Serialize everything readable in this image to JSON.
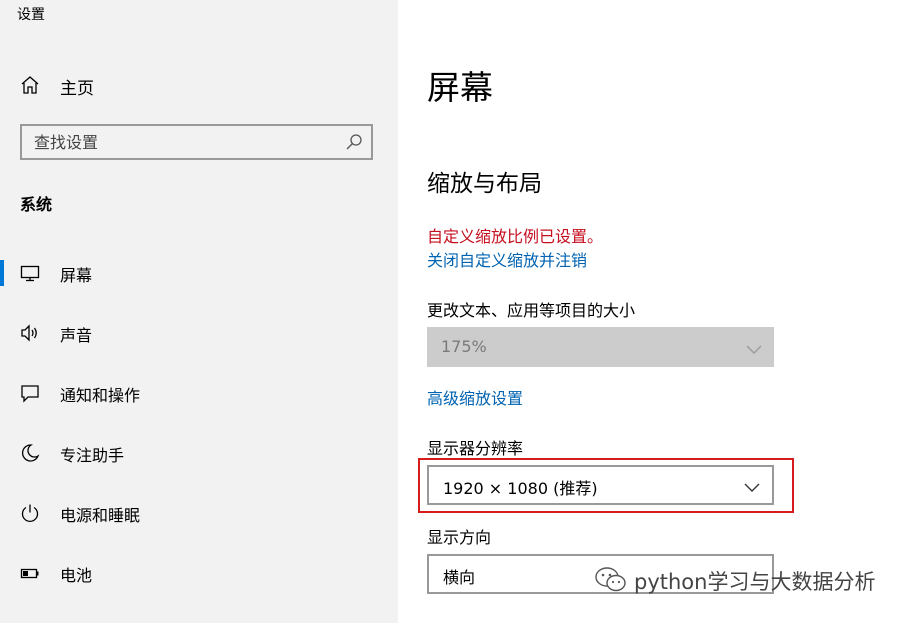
{
  "app": {
    "title": "设置"
  },
  "sidebar": {
    "home_label": "主页",
    "search": {
      "placeholder": "查找设置",
      "value": ""
    },
    "section_title": "系统",
    "items": [
      {
        "label": "屏幕",
        "icon": "monitor-icon",
        "selected": true
      },
      {
        "label": "声音",
        "icon": "speaker-icon",
        "selected": false
      },
      {
        "label": "通知和操作",
        "icon": "notification-icon",
        "selected": false
      },
      {
        "label": "专注助手",
        "icon": "moon-icon",
        "selected": false
      },
      {
        "label": "电源和睡眠",
        "icon": "power-icon",
        "selected": false
      },
      {
        "label": "电池",
        "icon": "battery-icon",
        "selected": false
      }
    ]
  },
  "main": {
    "page_title": "屏幕",
    "section_title": "缩放与布局",
    "custom_scale_warning": "自定义缩放比例已设置。",
    "disable_custom_scale_link": "关闭自定义缩放并注销",
    "scale_label": "更改文本、应用等项目的大小",
    "scale_value": "175%",
    "advanced_scale_link": "高级缩放设置",
    "resolution_label": "显示器分辨率",
    "resolution_value": "1920 × 1080 (推荐)",
    "orientation_label": "显示方向",
    "orientation_value": "横向"
  },
  "watermark": {
    "text": "python学习与大数据分析"
  },
  "colors": {
    "accent": "#0078d7",
    "link": "#0063b1",
    "warning": "#c50f1f",
    "highlight_border": "#d61c1c",
    "sidebar_bg": "#f2f2f2",
    "disabled_bg": "#cccccc"
  }
}
